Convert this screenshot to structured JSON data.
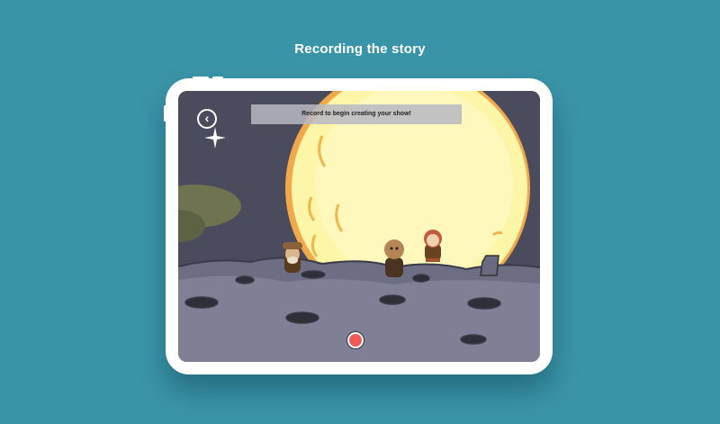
{
  "page": {
    "title": "Recording the story"
  },
  "app": {
    "back_icon": "chevron-left-icon",
    "prompt": "Record to begin creating your show!",
    "record_icon": "record-icon"
  },
  "colors": {
    "background": "#3a94a8",
    "sky": "#4a4a5c",
    "moon": "#fbf4a6",
    "moon_rim": "#f3b64a",
    "ground": "#7c7c92",
    "record": "#f05a5a"
  }
}
